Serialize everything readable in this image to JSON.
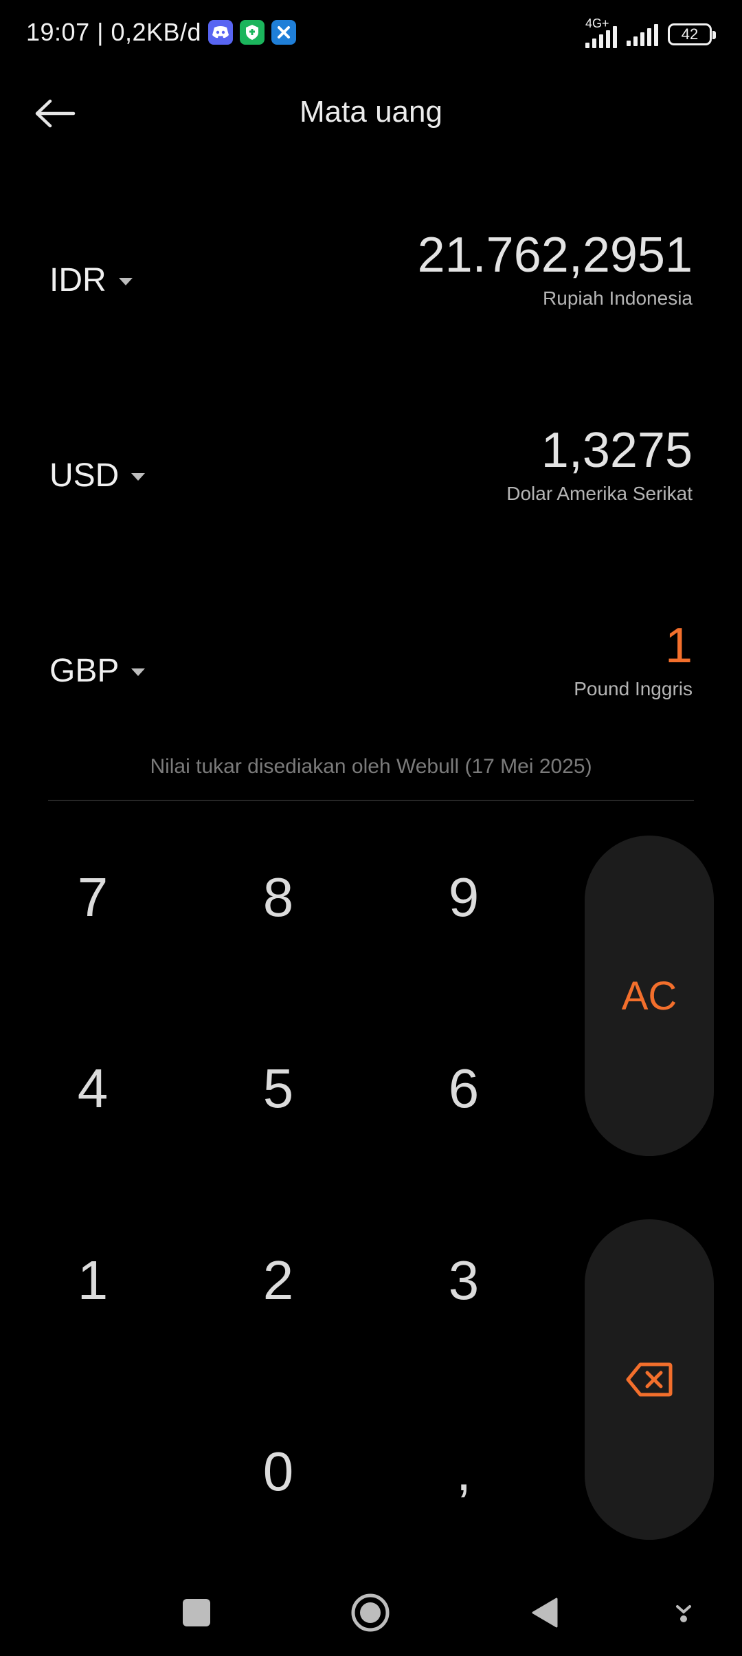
{
  "status_bar": {
    "time_speed": "19:07 | 0,2KB/d",
    "network": "4G+",
    "battery": "42",
    "app_icons": [
      "discord-icon",
      "vpn-shield-icon",
      "x-app-icon"
    ]
  },
  "header": {
    "title": "Mata uang"
  },
  "currencies": [
    {
      "code": "IDR",
      "amount": "21.762,2951",
      "name": "Rupiah Indonesia"
    },
    {
      "code": "USD",
      "amount": "1,3275",
      "name": "Dolar Amerika Serikat"
    },
    {
      "code": "GBP",
      "amount": "1",
      "name": "Pound Inggris"
    }
  ],
  "provider_note": "Nilai tukar disediakan oleh Webull (17 Mei 2025)",
  "keypad": {
    "k7": "7",
    "k8": "8",
    "k9": "9",
    "k4": "4",
    "k5": "5",
    "k6": "6",
    "k1": "1",
    "k2": "2",
    "k3": "3",
    "k0": "0",
    "comma": ",",
    "clear": "AC"
  },
  "colors": {
    "accent": "#f36f2c",
    "background": "#000000",
    "side_button": "#1c1c1c"
  }
}
